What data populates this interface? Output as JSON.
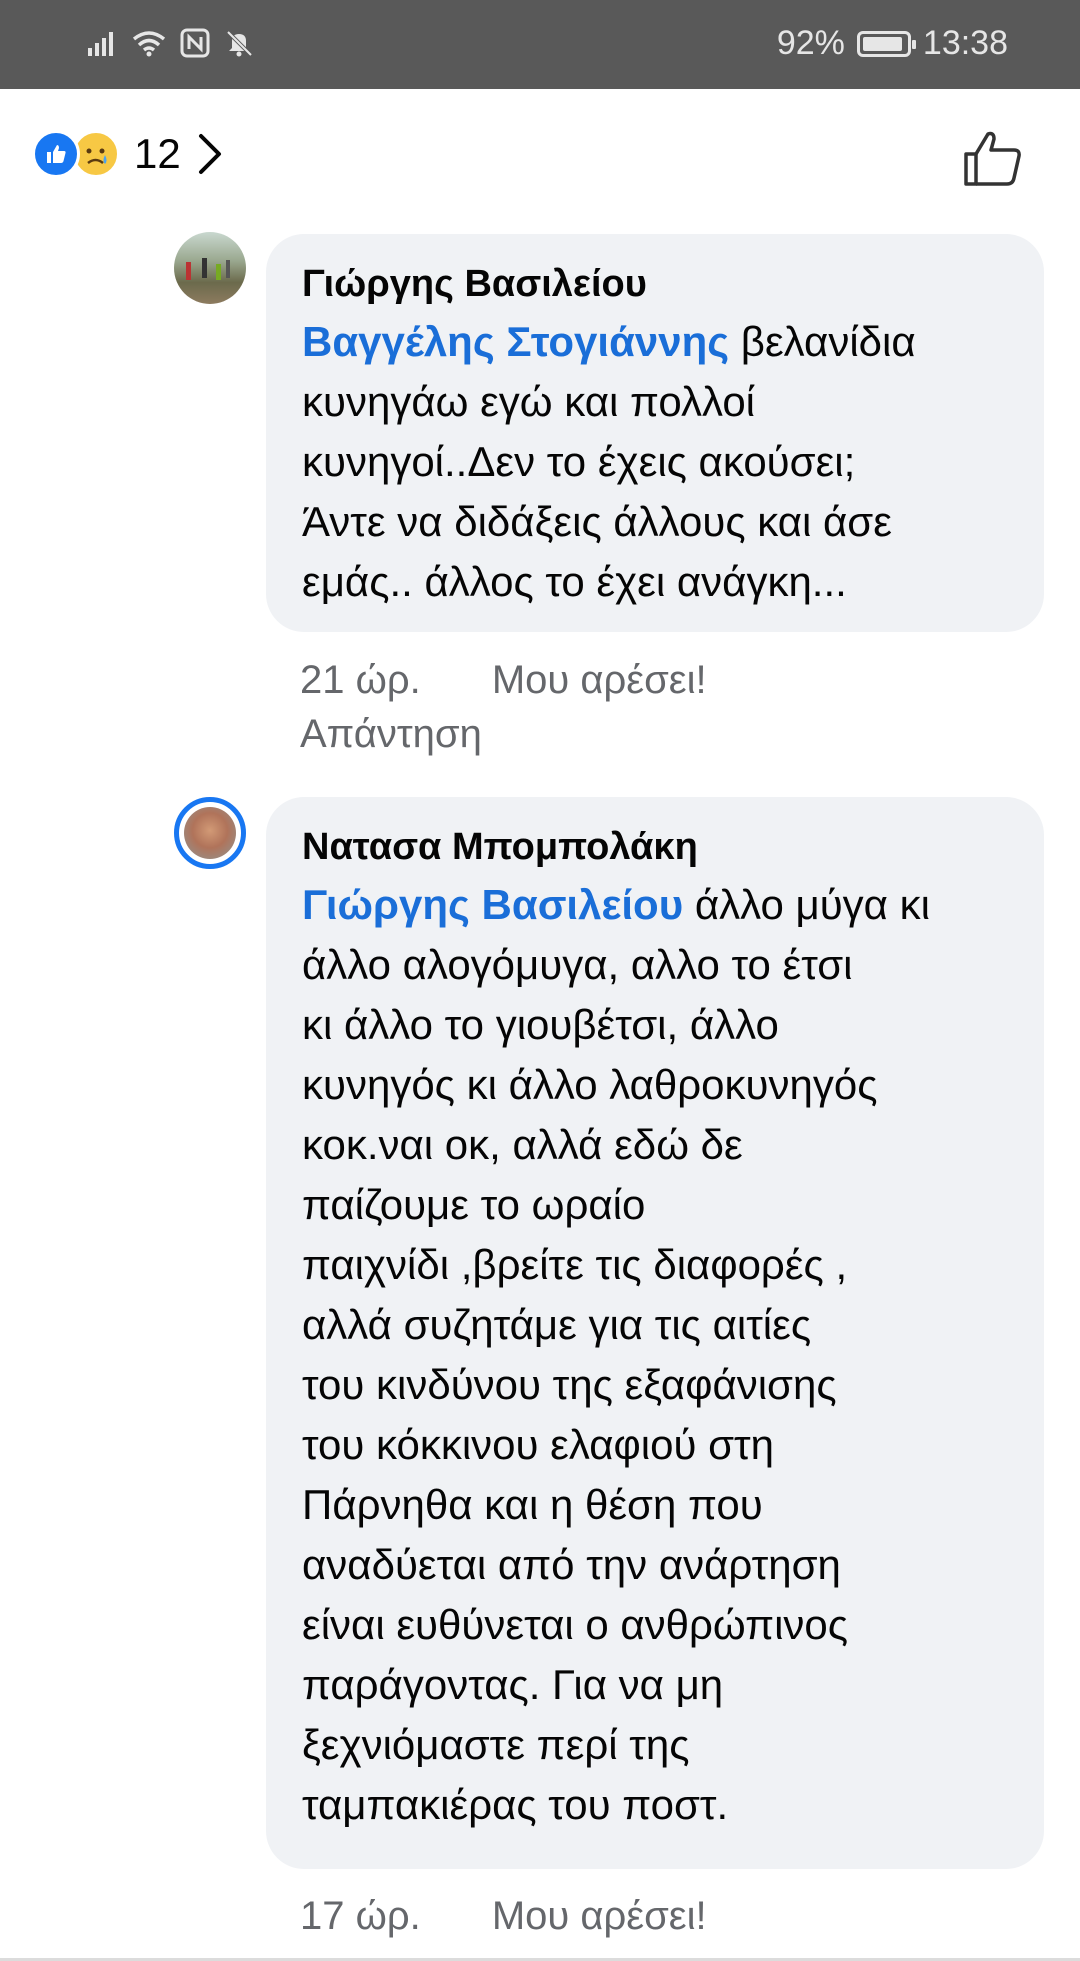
{
  "status_bar": {
    "battery": "92%",
    "battery_level": 0.92,
    "time": "13:38"
  },
  "reactions": {
    "count": "12",
    "icons": [
      "like-reaction",
      "sad-reaction"
    ]
  },
  "comments": [
    {
      "author": "Γιώργης Βασιλείου",
      "mention": "Βαγγέλης Στογιάννης",
      "lines": [
        " βελανίδια",
        "κυνηγάω εγώ και πολλοί",
        "κυνηγοί..Δεν το έχεις ακούσει;",
        "Άντε να διδάξεις άλλους και άσε",
        "εμάς.. άλλος το έχει ανάγκη..."
      ],
      "time": "21 ώρ.",
      "like": "Μου αρέσει!",
      "reply": "Απάντηση"
    },
    {
      "author": "Νατασα Μπομπολάκη",
      "mention": "Γιώργης Βασιλείου",
      "lines": [
        " άλλο μύγα κι",
        "άλλο αλογόμυγα, αλλο το έτσι",
        "κι άλλο το γιουβέτσι, άλλο",
        "κυνηγός κι άλλο λαθροκυνηγός",
        "κοκ.ναι οκ, αλλά εδώ δε",
        "παίζουμε το ωραίο",
        "παιχνίδι ,βρείτε τις διαφορές ,",
        "αλλά συζητάμε για τις αιτίες",
        "του κινδύνου της εξαφάνισης",
        "του κόκκινου ελαφιού στη",
        "Πάρνηθα και η θέση που",
        "αναδύεται από την ανάρτηση",
        "είναι ευθύνεται ο ανθρώπινος",
        "παράγοντας. Για να μη",
        "ξεχνιόμαστε περί της",
        "ταμπακιέρας του ποστ."
      ],
      "time": "17 ώρ.",
      "like": "Μου αρέσει!"
    }
  ]
}
